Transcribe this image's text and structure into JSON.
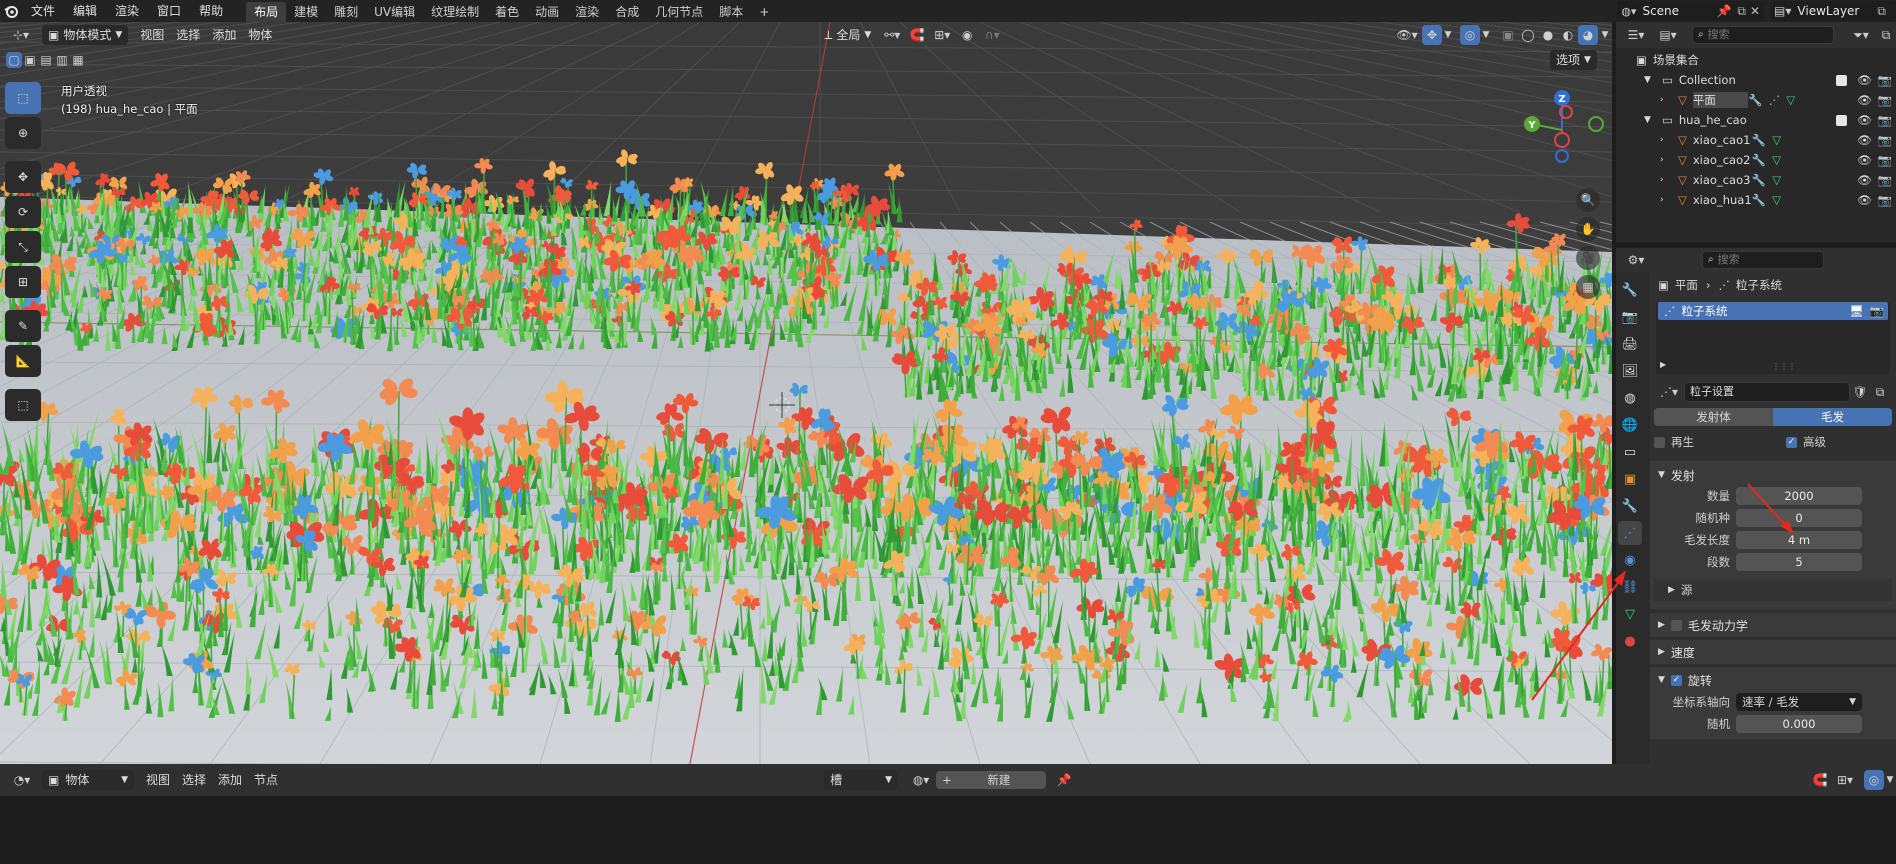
{
  "topbar": {
    "menus": [
      "文件",
      "编辑",
      "渲染",
      "窗口",
      "帮助"
    ],
    "workspaces": [
      "布局",
      "建模",
      "雕刻",
      "UV编辑",
      "纹理绘制",
      "着色",
      "动画",
      "渲染",
      "合成",
      "几何节点",
      "脚本"
    ],
    "add_tab": "+",
    "scene": "Scene",
    "view_layer": "ViewLayer"
  },
  "viewport": {
    "mode": "物体模式",
    "menus": [
      "视图",
      "选择",
      "添加",
      "物体"
    ],
    "transform_orientation": "全局",
    "options": "选项",
    "title": "用户透视",
    "subtitle": "(198) hua_he_cao | 平面",
    "gizmo": {
      "z": "Z",
      "y": "Y"
    }
  },
  "outliner": {
    "search_placeholder": "搜索",
    "scene_collection": "场景集合",
    "rows": [
      {
        "label": "Collection",
        "type": "collection"
      },
      {
        "label": "平面",
        "type": "object"
      },
      {
        "label": "hua_he_cao",
        "type": "collection"
      },
      {
        "label": "xiao_cao1",
        "type": "object"
      },
      {
        "label": "xiao_cao2",
        "type": "object"
      },
      {
        "label": "xiao_cao3",
        "type": "object"
      },
      {
        "label": "xiao_hua1",
        "type": "object"
      }
    ]
  },
  "properties": {
    "search_placeholder": "搜索",
    "breadcrumb": [
      "平面",
      "粒子系统"
    ],
    "particle_system_item": "粒子系统",
    "settings_name": "粒子设置",
    "type_emitter": "发射体",
    "type_hair": "毛发",
    "regrow": "再生",
    "advanced": "高级",
    "emission": {
      "title": "发射",
      "count_label": "数量",
      "count": "2000",
      "seed_label": "随机种",
      "seed": "0",
      "hair_length_label": "毛发长度",
      "hair_length": "4 m",
      "segments_label": "段数",
      "segments": "5",
      "source": "源"
    },
    "hair_dynamics": "毛发动力学",
    "velocity": "速度",
    "rotation": {
      "title": "旋转",
      "orientation_axis_label": "坐标系轴向",
      "orientation_axis": "速率 / 毛发",
      "random_label": "随机",
      "random": "0.000"
    }
  },
  "bottombar": {
    "editor": "物体",
    "menus": [
      "视图",
      "选择",
      "添加",
      "节点"
    ],
    "slot": "槽",
    "new_label": "新建"
  },
  "colors": {
    "accent": "#4772b3",
    "header": "#303030",
    "arrow": "#e8281e"
  }
}
